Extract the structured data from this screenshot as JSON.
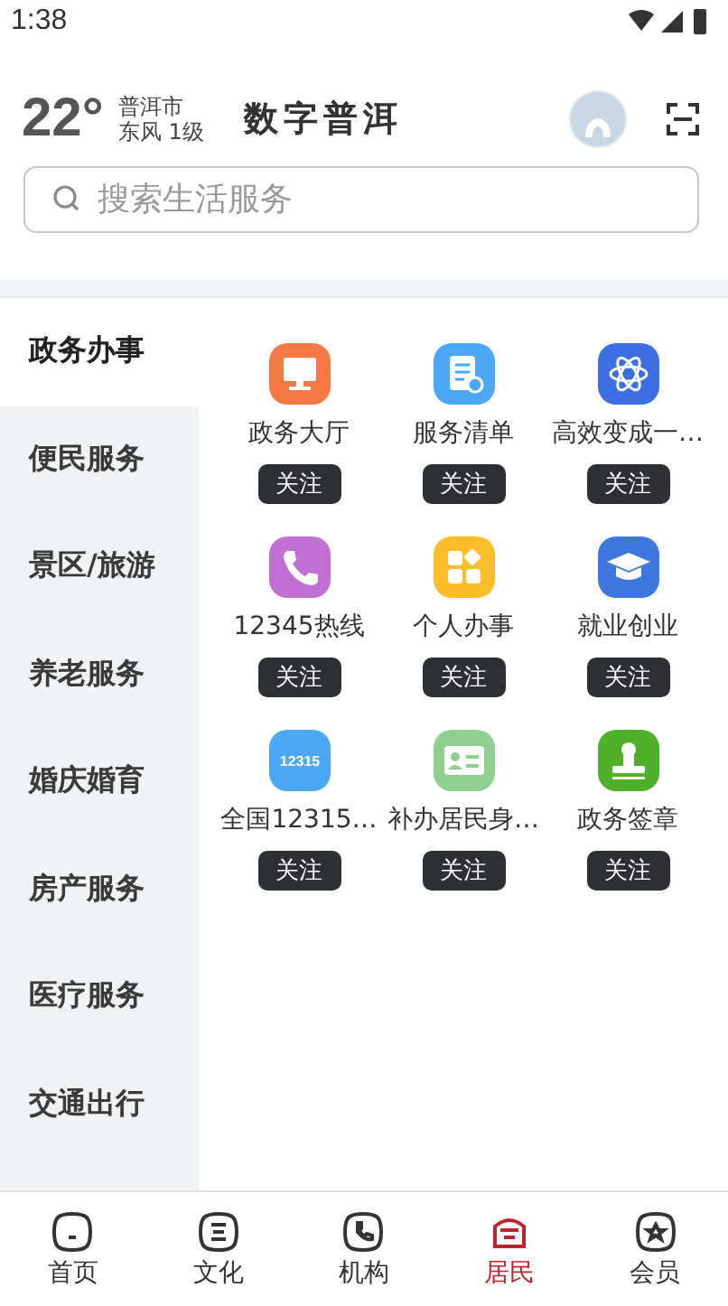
{
  "status_bar": {
    "time": "1:38"
  },
  "header": {
    "temperature": "22°",
    "city": "普洱市",
    "wind": "东风 1级",
    "logo": "数字普洱"
  },
  "search": {
    "placeholder": "搜索生活服务"
  },
  "sidebar": {
    "items": [
      {
        "label": "政务办事",
        "selected": true
      },
      {
        "label": "便民服务",
        "selected": false
      },
      {
        "label": "景区/旅游",
        "selected": false
      },
      {
        "label": "养老服务",
        "selected": false
      },
      {
        "label": "婚庆婚育",
        "selected": false
      },
      {
        "label": "房产服务",
        "selected": false
      },
      {
        "label": "医疗服务",
        "selected": false
      },
      {
        "label": "交通出行",
        "selected": false
      }
    ]
  },
  "services": [
    {
      "name": "政务大厅",
      "kind": "monitor",
      "color": "#f47a45",
      "follow": "关注"
    },
    {
      "name": "服务清单",
      "kind": "document",
      "color": "#4aa8f5",
      "follow": "关注"
    },
    {
      "name": "高效变成一…",
      "kind": "atom",
      "color": "#3d6fe0",
      "follow": "关注"
    },
    {
      "name": "12345热线",
      "kind": "phone",
      "color": "#c070d0",
      "follow": "关注"
    },
    {
      "name": "个人办事",
      "kind": "grid",
      "color": "#fbbd2a",
      "follow": "关注"
    },
    {
      "name": "就业创业",
      "kind": "cap",
      "color": "#3d78e0",
      "follow": "关注"
    },
    {
      "name": "全国12315…",
      "kind": "badge",
      "color": "#4aa8f5",
      "follow": "关注",
      "badge": "12315"
    },
    {
      "name": "补办居民身…",
      "kind": "card",
      "color": "#8fcf8f",
      "follow": "关注"
    },
    {
      "name": "政务签章",
      "kind": "stamp",
      "color": "#4fb02a",
      "follow": "关注"
    }
  ],
  "bottom_nav": [
    {
      "label": "首页",
      "kind": "home",
      "selected": false
    },
    {
      "label": "文化",
      "kind": "list",
      "selected": false
    },
    {
      "label": "机构",
      "kind": "phone",
      "selected": false
    },
    {
      "label": "居民",
      "kind": "house",
      "selected": true
    },
    {
      "label": "会员",
      "kind": "star",
      "selected": false
    }
  ]
}
